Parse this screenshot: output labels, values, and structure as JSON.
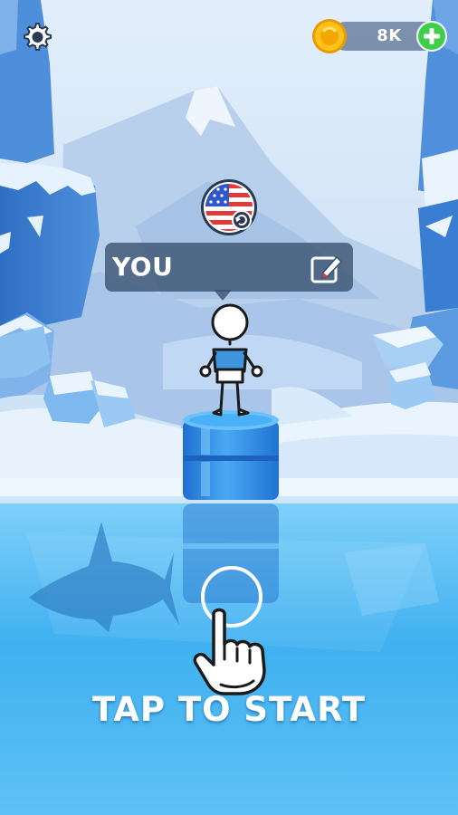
{
  "hud": {
    "coins": "8K",
    "coin_icon": "coin-icon",
    "add_icon": "plus-icon",
    "settings_icon": "gear-icon"
  },
  "player": {
    "name": "YOU",
    "country_flag": "usa-flag-icon",
    "edit_icon": "edit-pencil-icon"
  },
  "prompt": {
    "text": "TAP TO START",
    "hint_icon": "tap-hand-icon"
  },
  "colors": {
    "sky": "#dbe9f8",
    "ice": "#5c9fe0",
    "water": "#48b3f0",
    "coin": "#f5b700",
    "add": "#3ecf4a",
    "name_box": "#37506e",
    "pillar": "#2f8ee6"
  }
}
